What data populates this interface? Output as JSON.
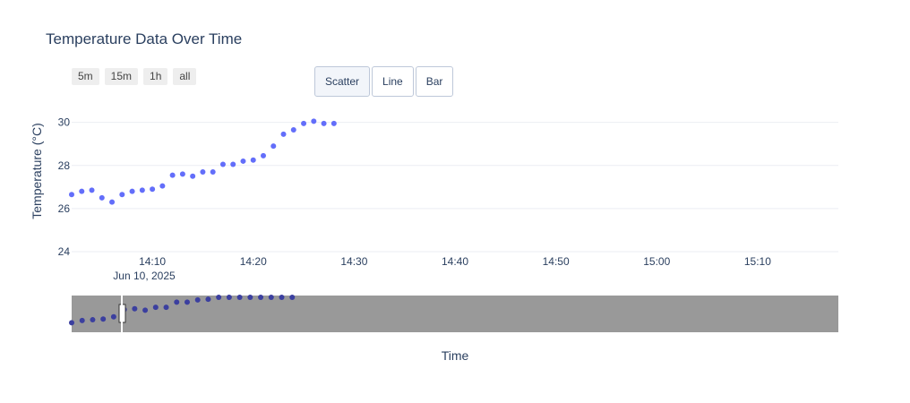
{
  "title": "Temperature Data Over Time",
  "range_buttons": [
    "5m",
    "15m",
    "1h",
    "all"
  ],
  "type_buttons": [
    {
      "label": "Scatter",
      "active": true
    },
    {
      "label": "Line",
      "active": false
    },
    {
      "label": "Bar",
      "active": false
    }
  ],
  "chart_data": {
    "type": "scatter",
    "title": "Temperature Data Over Time",
    "xlabel": "Time",
    "ylabel": "Temperature (°C)",
    "xlim": [
      "14:02",
      "15:18"
    ],
    "ylim": [
      24,
      30.4
    ],
    "x_ticks": [
      "14:10",
      "14:20",
      "14:30",
      "14:40",
      "14:50",
      "15:00",
      "15:10"
    ],
    "x_tick_date": "Jun 10, 2025",
    "y_ticks": [
      24,
      26,
      28,
      30
    ],
    "grid": true,
    "marker_color": "#636efa",
    "x": [
      "14:02",
      "14:03",
      "14:04",
      "14:05",
      "14:06",
      "14:07",
      "14:08",
      "14:09",
      "14:10",
      "14:11",
      "14:12",
      "14:13",
      "14:14",
      "14:15",
      "14:16",
      "14:17",
      "14:18",
      "14:19",
      "14:20",
      "14:21",
      "14:22",
      "14:23",
      "14:24",
      "14:25",
      "14:26",
      "14:27",
      "14:28"
    ],
    "y": [
      26.65,
      26.8,
      26.85,
      26.5,
      26.3,
      26.65,
      26.8,
      26.85,
      26.9,
      27.05,
      27.55,
      27.6,
      27.5,
      27.7,
      27.7,
      28.05,
      28.05,
      28.2,
      28.25,
      28.45,
      28.9,
      29.45,
      29.65,
      29.95,
      30.05,
      29.95,
      29.95
    ],
    "rangeslider": {
      "visible": true,
      "background": "#999999",
      "marker_color": "#3b3f9f"
    }
  }
}
